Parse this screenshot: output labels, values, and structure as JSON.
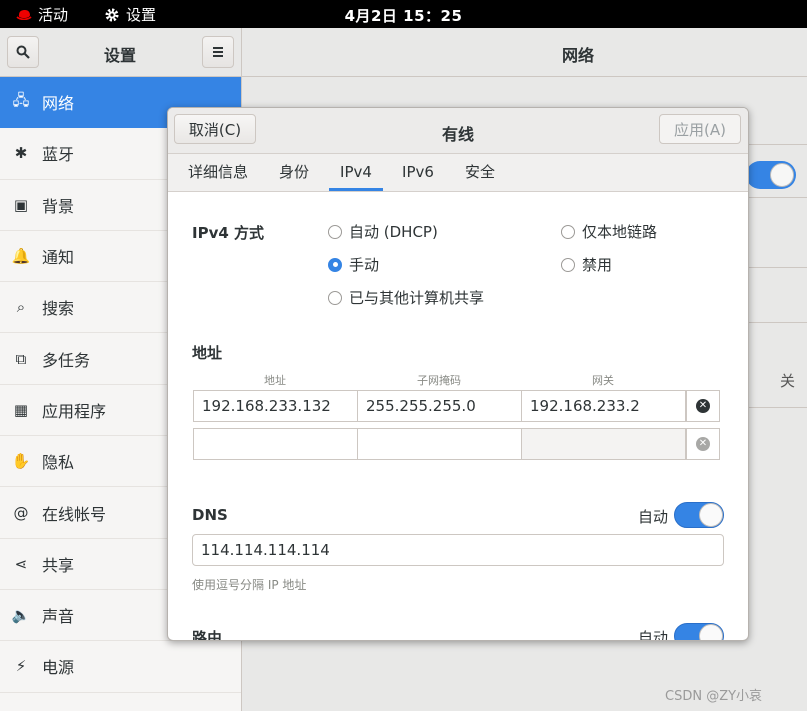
{
  "topbar": {
    "activities": "活动",
    "app": "设置",
    "clock": "4月2日  15：25"
  },
  "header": {
    "sidebar_title": "设置",
    "main_title": "网络"
  },
  "sidebar": {
    "items": [
      {
        "label": "网络",
        "icon": "network-icon",
        "glyph": "🖧"
      },
      {
        "label": "蓝牙",
        "icon": "bluetooth-icon",
        "glyph": "✱"
      },
      {
        "label": "背景",
        "icon": "background-icon",
        "glyph": "▣"
      },
      {
        "label": "通知",
        "icon": "bell-icon",
        "glyph": "🔔"
      },
      {
        "label": "搜索",
        "icon": "search-icon",
        "glyph": "⌕"
      },
      {
        "label": "多任务",
        "icon": "multitasking-icon",
        "glyph": "⧉"
      },
      {
        "label": "应用程序",
        "icon": "apps-grid-icon",
        "glyph": "▦"
      },
      {
        "label": "隐私",
        "icon": "hand-icon",
        "glyph": "✋"
      },
      {
        "label": "在线帐号",
        "icon": "at-icon",
        "glyph": "@"
      },
      {
        "label": "共享",
        "icon": "share-icon",
        "glyph": "⋖"
      },
      {
        "label": "声音",
        "icon": "speaker-icon",
        "glyph": "🔈"
      },
      {
        "label": "电源",
        "icon": "power-icon",
        "glyph": "⚡"
      }
    ]
  },
  "background": {
    "off_label": "关"
  },
  "dialog": {
    "cancel_label": "取消(C)",
    "title": "有线",
    "apply_label": "应用(A)",
    "tabs": [
      "详细信息",
      "身份",
      "IPv4",
      "IPv6",
      "安全"
    ],
    "active_tab": "IPv4",
    "method_label": "IPv4 方式",
    "methods": {
      "auto_dhcp": "自动 (DHCP)",
      "link_local": "仅本地链路",
      "manual": "手动",
      "disabled": "禁用",
      "shared": "已与其他计算机共享"
    },
    "selected_method": "手动",
    "address_section": "地址",
    "columns": {
      "address": "地址",
      "netmask": "子网掩码",
      "gateway": "网关"
    },
    "rows": [
      {
        "address": "192.168.233.132",
        "netmask": "255.255.255.0",
        "gateway": "192.168.233.2"
      },
      {
        "address": "",
        "netmask": "",
        "gateway": ""
      }
    ],
    "dns": {
      "label": "DNS",
      "auto_label": "自动",
      "auto_on": true,
      "value": "114.114.114.114",
      "hint": "使用逗号分隔 IP 地址"
    },
    "routes": {
      "label": "路由",
      "auto_label": "自动",
      "auto_on": true
    }
  },
  "watermark": "CSDN @ZY小哀"
}
